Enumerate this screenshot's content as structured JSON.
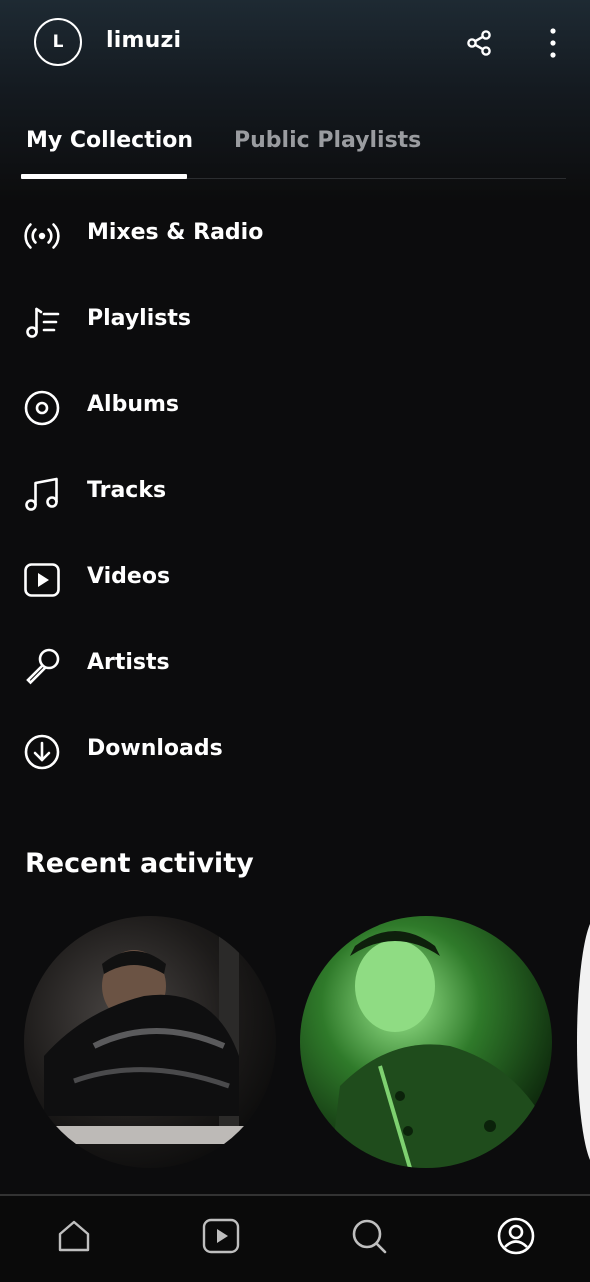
{
  "profile": {
    "initial": "L",
    "username": "limuzi"
  },
  "topbar": {
    "share_icon": "share-icon",
    "more_icon": "more-vertical-icon"
  },
  "tabs": [
    {
      "label": "My Collection",
      "active": true
    },
    {
      "label": "Public Playlists",
      "active": false
    }
  ],
  "menu": [
    {
      "label": "Mixes & Radio",
      "icon": "radio-icon"
    },
    {
      "label": "Playlists",
      "icon": "playlist-icon"
    },
    {
      "label": "Albums",
      "icon": "album-icon"
    },
    {
      "label": "Tracks",
      "icon": "music-note-icon"
    },
    {
      "label": "Videos",
      "icon": "video-icon"
    },
    {
      "label": "Artists",
      "icon": "microphone-icon"
    },
    {
      "label": "Downloads",
      "icon": "download-icon"
    }
  ],
  "recent": {
    "title": "Recent activity"
  },
  "bottom_nav": [
    {
      "icon": "home-icon",
      "active": false
    },
    {
      "icon": "play-icon",
      "active": false
    },
    {
      "icon": "search-icon",
      "active": false
    },
    {
      "icon": "profile-icon",
      "active": true
    }
  ],
  "colors": {
    "background": "#0c0c0d",
    "header_gradient_top": "#1e2a33",
    "inactive_text": "#9a9ca0",
    "accent": "#ffffff"
  }
}
